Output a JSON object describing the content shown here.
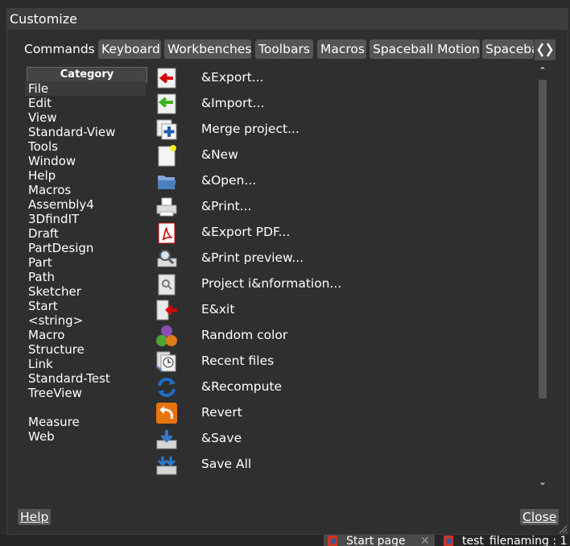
{
  "window": {
    "title": "Customize"
  },
  "tabs": [
    {
      "label": "Commands",
      "active": true
    },
    {
      "label": "Keyboard",
      "active": false
    },
    {
      "label": "Workbenches",
      "active": false
    },
    {
      "label": "Toolbars",
      "active": false
    },
    {
      "label": "Macros",
      "active": false
    },
    {
      "label": "Spaceball Motion",
      "active": false
    },
    {
      "label": "Spaceba",
      "active": false
    }
  ],
  "category": {
    "header": "Category",
    "items": [
      "File",
      "Edit",
      "View",
      "Standard-View",
      "Tools",
      "Window",
      "Help",
      "Macros",
      "Assembly4",
      "3DfindIT",
      "Draft",
      "PartDesign",
      "Part",
      "Path",
      "Sketcher",
      "Start",
      "<string>",
      "Macro",
      "Structure",
      "Link",
      "Standard-Test",
      "TreeView",
      "",
      "Measure",
      "Web"
    ],
    "selected": "File"
  },
  "commands": [
    {
      "label": "&Export...",
      "icon": "export-icon"
    },
    {
      "label": "&Import...",
      "icon": "import-icon"
    },
    {
      "label": "Merge project...",
      "icon": "merge-project-icon"
    },
    {
      "label": "&New",
      "icon": "new-document-icon"
    },
    {
      "label": "&Open...",
      "icon": "open-folder-icon"
    },
    {
      "label": "&Print...",
      "icon": "print-icon"
    },
    {
      "label": "&Export PDF...",
      "icon": "pdf-icon"
    },
    {
      "label": "&Print preview...",
      "icon": "print-preview-icon"
    },
    {
      "label": "Project i&nformation...",
      "icon": "project-info-icon"
    },
    {
      "label": "E&xit",
      "icon": "exit-icon"
    },
    {
      "label": "Random color",
      "icon": "random-color-icon"
    },
    {
      "label": "Recent files",
      "icon": "recent-files-icon"
    },
    {
      "label": "&Recompute",
      "icon": "recompute-icon"
    },
    {
      "label": "Revert",
      "icon": "revert-icon"
    },
    {
      "label": "&Save",
      "icon": "save-icon"
    },
    {
      "label": "Save All",
      "icon": "save-all-icon"
    }
  ],
  "buttons": {
    "help": "Help",
    "close": "Close"
  },
  "taskbar": [
    {
      "label": "Start page",
      "active": true
    },
    {
      "label": "test_filenaming : 1",
      "active": false
    }
  ]
}
